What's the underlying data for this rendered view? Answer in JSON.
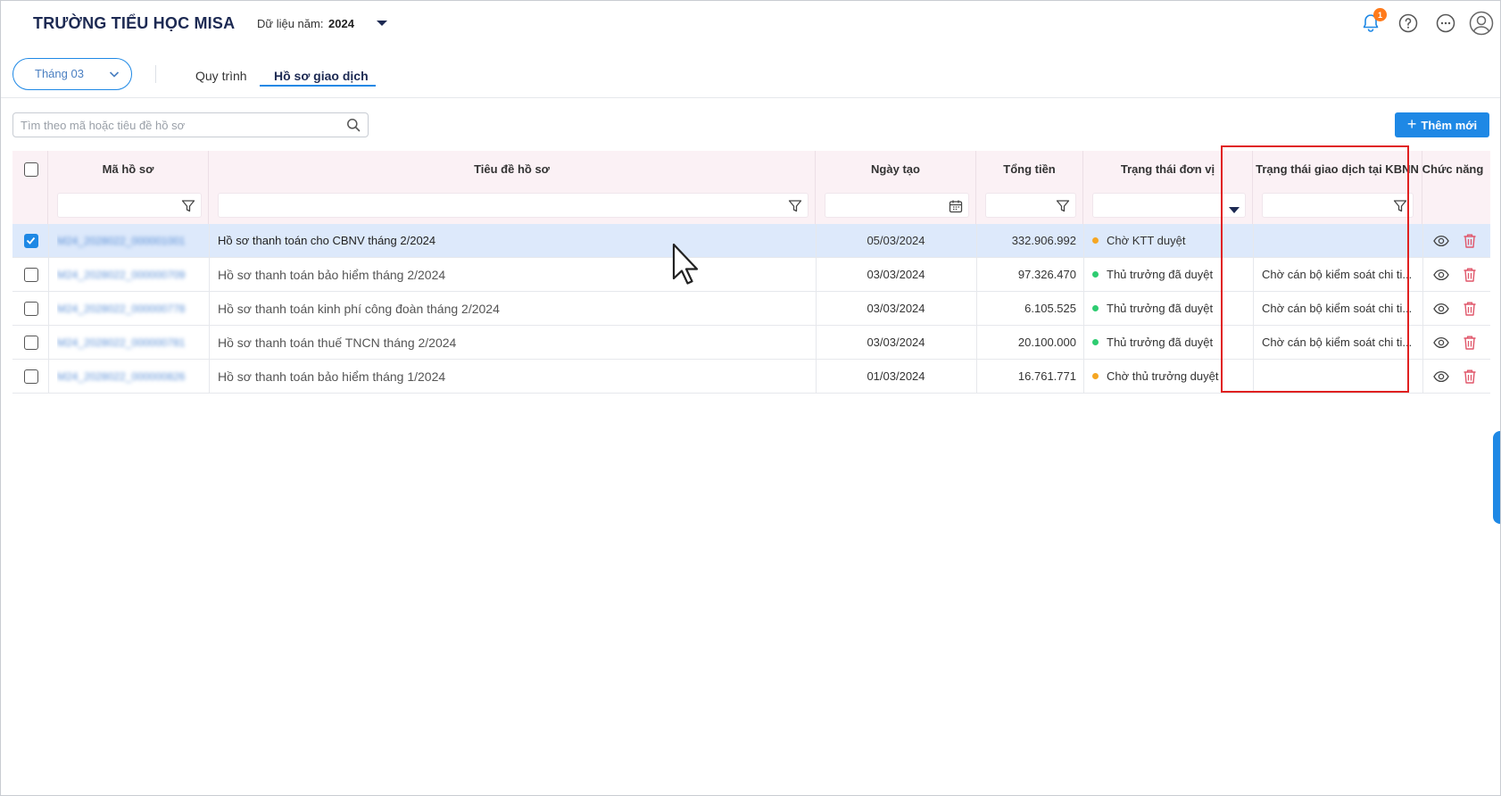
{
  "header": {
    "school_name": "TRƯỜNG TIỂU HỌC MISA",
    "year_label": "Dữ liệu năm:",
    "year_value": "2024",
    "notification_count": "1"
  },
  "toolbar": {
    "month_value": "Tháng 03",
    "tabs": [
      {
        "label": "Quy trình",
        "active": false
      },
      {
        "label": "Hồ sơ giao dịch",
        "active": true
      }
    ],
    "search_placeholder": "Tìm theo mã hoặc tiêu đề hồ sơ",
    "add_button": "Thêm mới"
  },
  "table": {
    "columns": {
      "code": "Mã hồ sơ",
      "title": "Tiêu đề hồ sơ",
      "date": "Ngày tạo",
      "amount": "Tổng tiền",
      "unit_status": "Trạng thái đơn vị",
      "kbnn_status": "Trạng thái giao dịch tại KBNN",
      "actions": "Chức năng"
    },
    "rows": [
      {
        "selected": true,
        "code": "M24_2028022_000001001",
        "title": "Hồ sơ thanh toán cho CBNV tháng 2/2024",
        "date": "05/03/2024",
        "amount": "332.906.992",
        "unit_status": "Chờ KTT duyệt",
        "status_color": "#f5a623",
        "kbnn_status": ""
      },
      {
        "selected": false,
        "code": "M24_2028022_000000709",
        "title": "Hồ sơ thanh toán bảo hiểm tháng 2/2024",
        "date": "03/03/2024",
        "amount": "97.326.470",
        "unit_status": "Thủ trưởng đã duyệt",
        "status_color": "#2ecc71",
        "kbnn_status": "Chờ cán bộ kiểm soát chi ti..."
      },
      {
        "selected": false,
        "code": "M24_2028022_000000778",
        "title": "Hồ sơ thanh toán kinh phí công đoàn tháng 2/2024",
        "date": "03/03/2024",
        "amount": "6.105.525",
        "unit_status": "Thủ trưởng đã duyệt",
        "status_color": "#2ecc71",
        "kbnn_status": "Chờ cán bộ kiểm soát chi ti..."
      },
      {
        "selected": false,
        "code": "M24_2028022_000000781",
        "title": "Hồ sơ thanh toán thuế TNCN tháng 2/2024",
        "date": "03/03/2024",
        "amount": "20.100.000",
        "unit_status": "Thủ trưởng đã duyệt",
        "status_color": "#2ecc71",
        "kbnn_status": "Chờ cán bộ kiểm soát chi ti..."
      },
      {
        "selected": false,
        "code": "M24_2028022_000000826",
        "title": "Hồ sơ thanh toán bảo hiểm tháng 1/2024",
        "date": "01/03/2024",
        "amount": "16.761.771",
        "unit_status": "Chờ thủ trưởng duyệt",
        "status_color": "#f5a623",
        "kbnn_status": ""
      }
    ]
  },
  "colors": {
    "accent": "#1e88e5",
    "brand_text": "#1d2a53",
    "header_bg": "#fbf1f5",
    "selected_row": "#dde9fb",
    "highlight_box": "#e02020",
    "delete_icon": "#e0566a"
  },
  "icons": [
    "bell-icon",
    "help-icon",
    "more-icon",
    "user-avatar-icon",
    "chevron-down-icon",
    "search-icon",
    "filter-icon",
    "calendar-icon",
    "eye-icon",
    "trash-icon",
    "plus-icon"
  ]
}
